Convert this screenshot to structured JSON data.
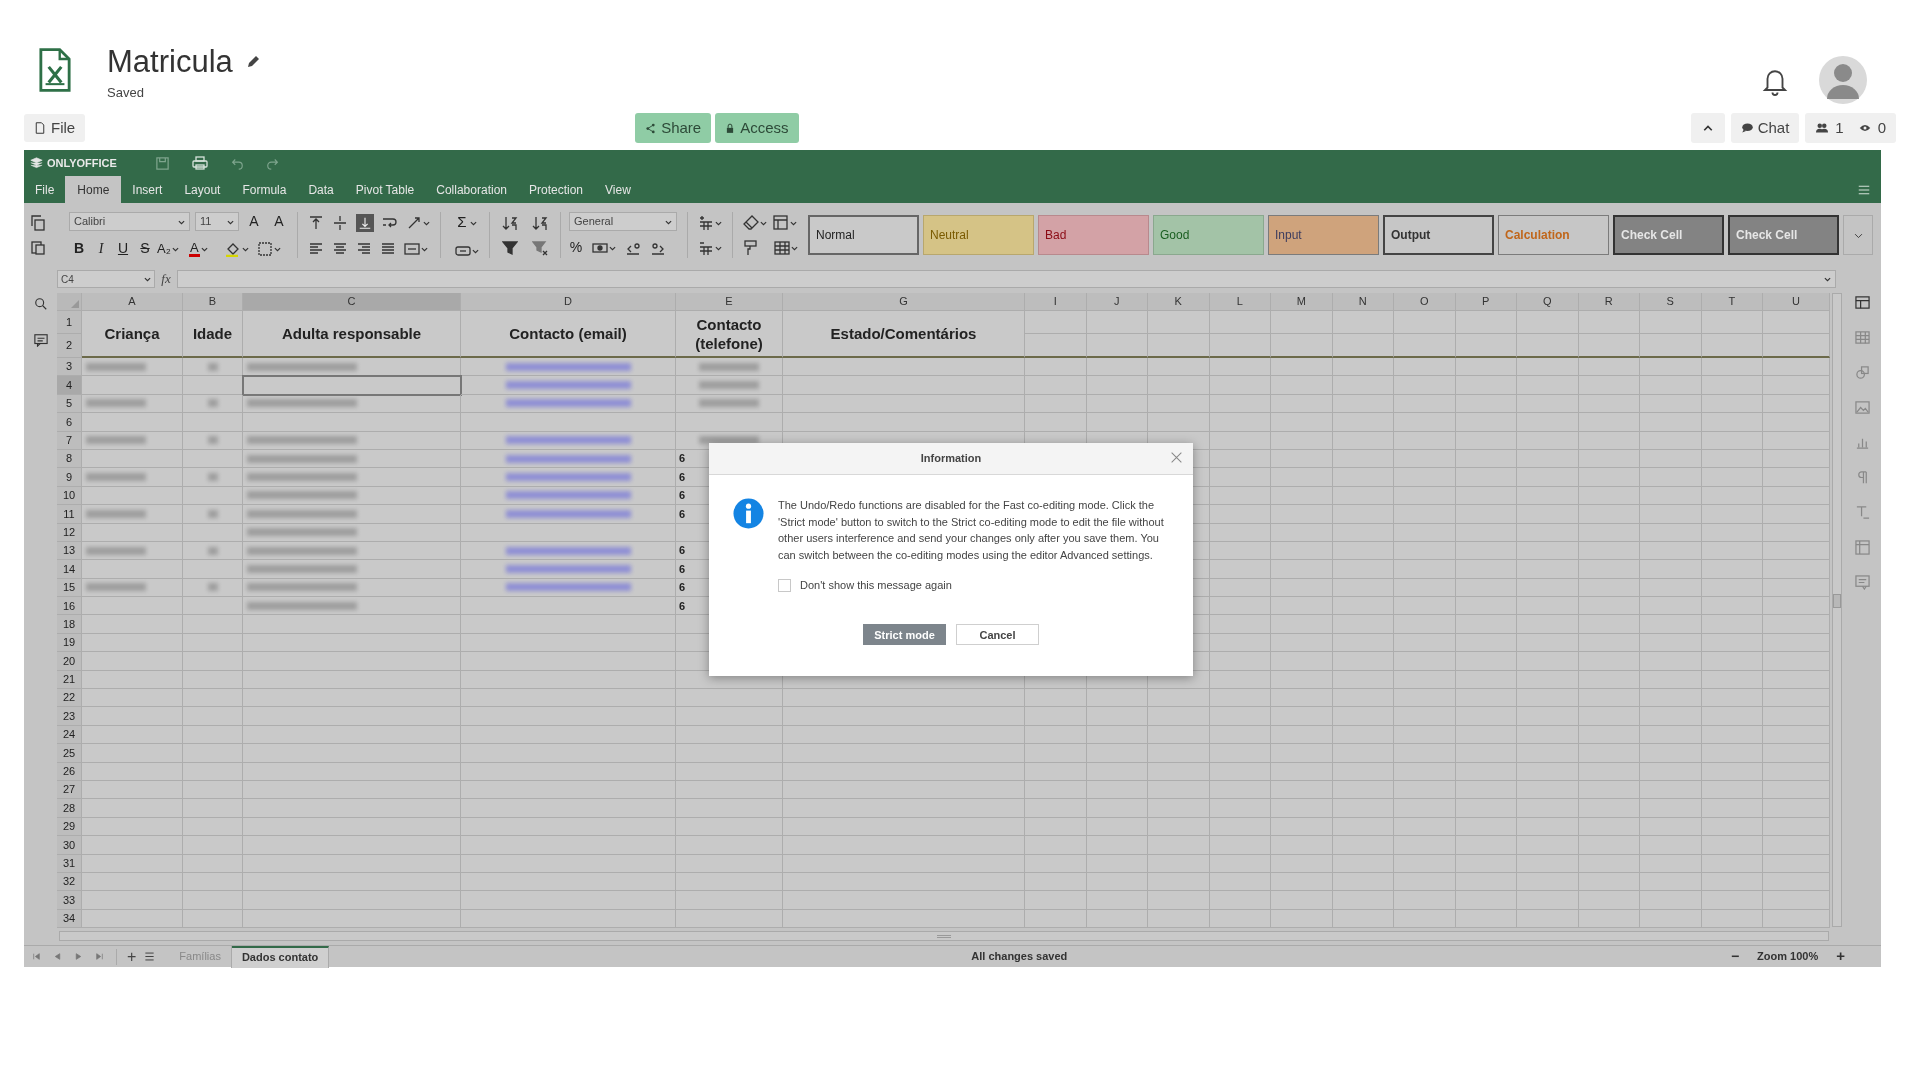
{
  "header": {
    "title": "Matricula",
    "status": "Saved",
    "file_button": "File",
    "share_button": "Share",
    "access_button": "Access",
    "chat_button": "Chat",
    "users_count": "1",
    "viewers_count": "0"
  },
  "editor": {
    "brand": "ONLYOFFICE",
    "tabs": [
      {
        "label": "File",
        "selected": false
      },
      {
        "label": "Home",
        "selected": true
      },
      {
        "label": "Insert",
        "selected": false
      },
      {
        "label": "Layout",
        "selected": false
      },
      {
        "label": "Formula",
        "selected": false
      },
      {
        "label": "Data",
        "selected": false
      },
      {
        "label": "Pivot Table",
        "selected": false
      },
      {
        "label": "Collaboration",
        "selected": false
      },
      {
        "label": "Protection",
        "selected": false
      },
      {
        "label": "View",
        "selected": false
      }
    ],
    "toolbar": {
      "font_name": "Calibri",
      "font_size": "11",
      "grow_font": "A",
      "shrink_font": "A",
      "bold": "B",
      "italic": "I",
      "underline": "U",
      "strike": "S",
      "subscript": "A₂",
      "font_color": "A",
      "sum": "Σ",
      "number_format": "General",
      "percent": "%"
    },
    "styles": [
      {
        "label": "Normal",
        "kind": "normal"
      },
      {
        "label": "Neutral",
        "kind": "neutral"
      },
      {
        "label": "Bad",
        "kind": "bad"
      },
      {
        "label": "Good",
        "kind": "good"
      },
      {
        "label": "Input",
        "kind": "input"
      },
      {
        "label": "Output",
        "kind": "output"
      },
      {
        "label": "Calculation",
        "kind": "calculation"
      },
      {
        "label": "Check Cell",
        "kind": "check"
      },
      {
        "label": "Check Cell",
        "kind": "check"
      }
    ],
    "name_box": "C4",
    "fx": "fx",
    "columns": [
      {
        "label": "A",
        "selected": false
      },
      {
        "label": "B",
        "selected": false
      },
      {
        "label": "C",
        "selected": true
      },
      {
        "label": "D",
        "selected": false
      },
      {
        "label": "E",
        "selected": false
      },
      {
        "label": "G",
        "selected": false
      },
      {
        "label": "I",
        "selected": false
      },
      {
        "label": "J",
        "selected": false
      },
      {
        "label": "K",
        "selected": false
      },
      {
        "label": "L",
        "selected": false
      },
      {
        "label": "M",
        "selected": false
      },
      {
        "label": "N",
        "selected": false
      },
      {
        "label": "O",
        "selected": false
      },
      {
        "label": "P",
        "selected": false
      },
      {
        "label": "Q",
        "selected": false
      },
      {
        "label": "R",
        "selected": false
      },
      {
        "label": "S",
        "selected": false
      },
      {
        "label": "T",
        "selected": false
      },
      {
        "label": "U",
        "selected": false
      }
    ],
    "header_row_labels": [
      "1",
      "2"
    ],
    "header_cells": [
      "Criança",
      "Idade",
      "Adulta responsable",
      "Contacto (email)",
      "Contacto\n(telefone)",
      "Estado/Comentários"
    ],
    "rows": [
      {
        "label": "3",
        "selected": false
      },
      {
        "label": "4",
        "selected": true
      },
      {
        "label": "5",
        "selected": false
      },
      {
        "label": "6",
        "selected": false
      },
      {
        "label": "7",
        "selected": false
      },
      {
        "label": "8",
        "selected": false,
        "phone": "6"
      },
      {
        "label": "9",
        "selected": false,
        "phone": "6"
      },
      {
        "label": "10",
        "selected": false,
        "phone": "6"
      },
      {
        "label": "11",
        "selected": false,
        "phone": "6"
      },
      {
        "label": "12",
        "selected": false
      },
      {
        "label": "13",
        "selected": false,
        "phone": "6"
      },
      {
        "label": "14",
        "selected": false,
        "phone": "6"
      },
      {
        "label": "15",
        "selected": false,
        "phone": "6"
      },
      {
        "label": "16",
        "selected": false,
        "phone": "6"
      },
      {
        "label": "18",
        "selected": false
      },
      {
        "label": "19",
        "selected": false
      },
      {
        "label": "20",
        "selected": false
      },
      {
        "label": "21",
        "selected": false
      },
      {
        "label": "22",
        "selected": false
      },
      {
        "label": "23",
        "selected": false
      },
      {
        "label": "24",
        "selected": false
      },
      {
        "label": "25",
        "selected": false
      },
      {
        "label": "26",
        "selected": false
      },
      {
        "label": "27",
        "selected": false
      },
      {
        "label": "28",
        "selected": false
      },
      {
        "label": "29",
        "selected": false
      },
      {
        "label": "30",
        "selected": false
      },
      {
        "label": "31",
        "selected": false
      },
      {
        "label": "32",
        "selected": false
      },
      {
        "label": "33",
        "selected": false
      },
      {
        "label": "34",
        "selected": false
      }
    ],
    "sheets": [
      {
        "label": "Famílias",
        "selected": false
      },
      {
        "label": "Dados contato",
        "selected": true
      }
    ],
    "add_sheet": "+",
    "status": "All changes saved",
    "zoom_out": "−",
    "zoom": "Zoom 100%",
    "zoom_in": "+"
  },
  "dialog": {
    "title": "Information",
    "message": "The Undo/Redo functions are disabled for the Fast co-editing mode. Click the 'Strict mode' button to switch to the Strict co-editing mode to edit the file without other users interference and send your changes only after you save them. You can switch between the co-editing modes using the editor Advanced settings.",
    "checkbox": {
      "label": "Don't show this message again",
      "checked": false
    },
    "primary_button": "Strict mode",
    "cancel_button": "Cancel"
  }
}
